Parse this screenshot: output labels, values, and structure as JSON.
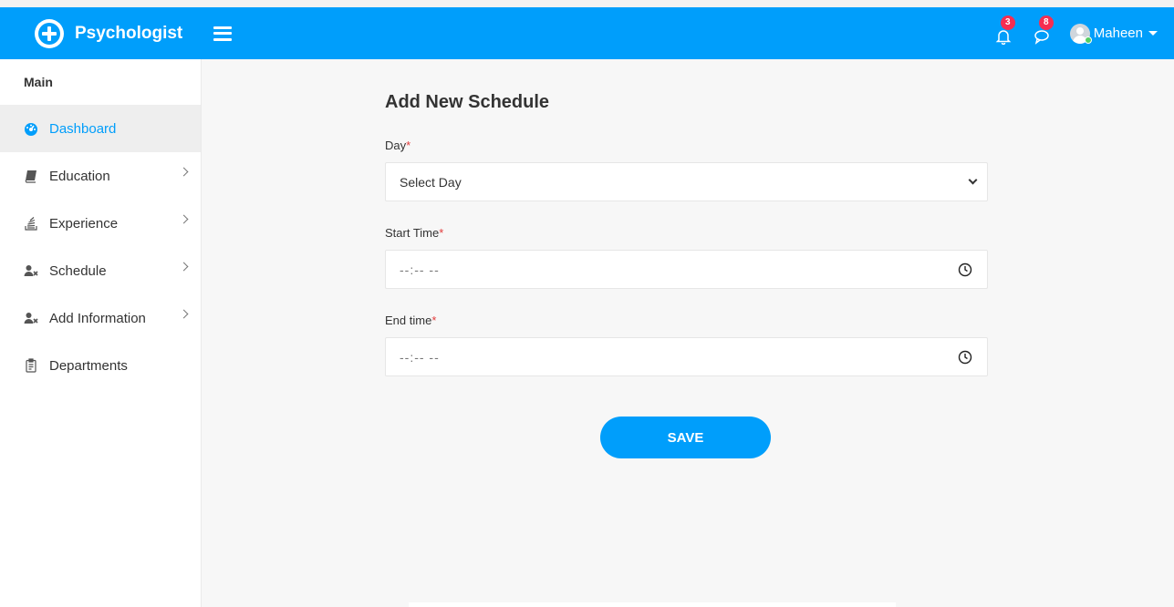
{
  "brand": {
    "name": "Psychologist"
  },
  "header": {
    "notifications_count": "3",
    "messages_count": "8",
    "user_name": "Maheen"
  },
  "sidebar": {
    "title": "Main",
    "items": [
      {
        "label": "Dashboard",
        "icon": "dashboard-icon",
        "active": true
      },
      {
        "label": "Education",
        "icon": "book-icon",
        "has_submenu": true
      },
      {
        "label": "Experience",
        "icon": "stack-icon",
        "has_submenu": true
      },
      {
        "label": "Schedule",
        "icon": "user-times-icon",
        "has_submenu": true
      },
      {
        "label": "Add Information",
        "icon": "user-times-icon",
        "has_submenu": true
      },
      {
        "label": "Departments",
        "icon": "clipboard-icon"
      }
    ]
  },
  "form": {
    "title": "Add New Schedule",
    "day_label": "Day",
    "day_selected": "Select Day",
    "start_label": "Start Time",
    "start_placeholder": "--:-- --",
    "end_label": "End time",
    "end_placeholder": "--:-- --",
    "required_mark": "*",
    "save_label": "SAVE"
  },
  "colors": {
    "primary": "#009efb",
    "badge": "#f62d51",
    "required": "#e23c3c",
    "online": "#55ce63"
  }
}
